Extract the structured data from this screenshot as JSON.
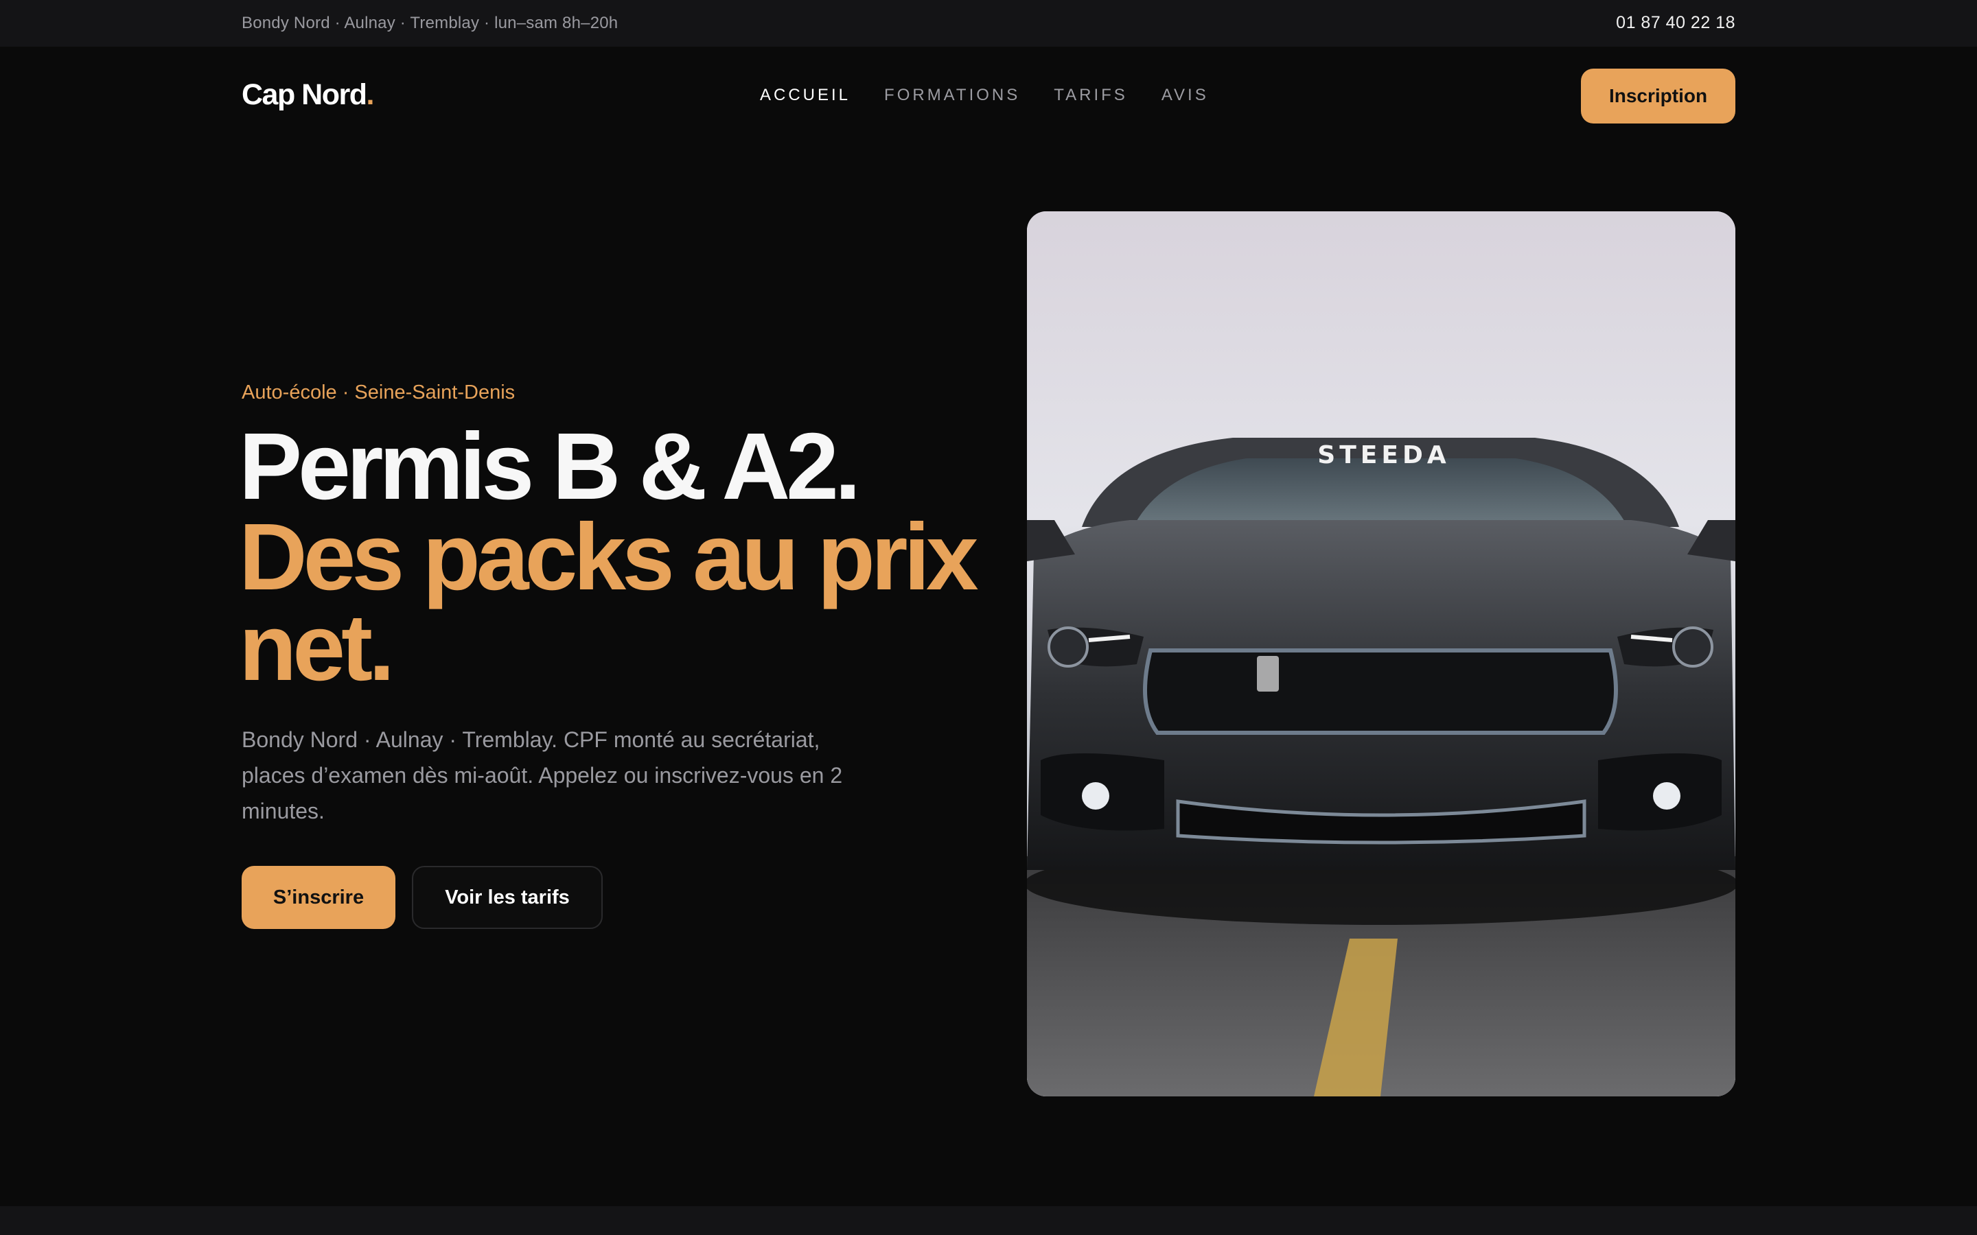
{
  "topbar": {
    "locations": "Bondy Nord · Aulnay · Tremblay · lun–sam 8h–20h",
    "phone": "01 87 40 22 18"
  },
  "nav": {
    "logo_text": "Cap Nord",
    "logo_dot": ".",
    "items": [
      {
        "label": "ACCUEIL",
        "active": true
      },
      {
        "label": "FORMATIONS",
        "active": false
      },
      {
        "label": "TARIFS",
        "active": false
      },
      {
        "label": "AVIS",
        "active": false
      }
    ],
    "cta": "Inscription"
  },
  "hero": {
    "eyebrow": "Auto-école · Seine-Saint-Denis",
    "headline_line1": "Permis B & A2.",
    "headline_line2": "Des packs au prix net.",
    "lede": "Bondy Nord · Aulnay · Tremblay. CPF monté au secrétariat, places d’examen dès mi-août. Appelez ou inscrivez-vous en 2 minutes.",
    "primary_button": "S’inscrire",
    "secondary_button": "Voir les tarifs",
    "image_windshield_text": "STEEDA"
  },
  "colors": {
    "accent": "#e8a35a",
    "background": "#0a0a0a",
    "topbar": "#141416",
    "muted_text": "#9a9aa0"
  }
}
